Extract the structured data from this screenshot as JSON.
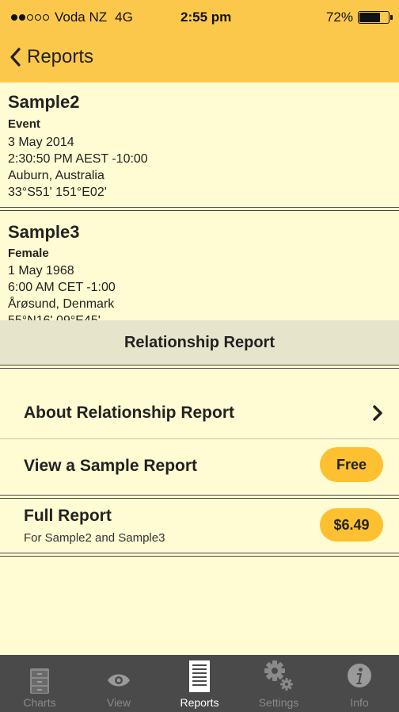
{
  "status_bar": {
    "carrier": "Voda NZ",
    "network": "4G",
    "time": "2:55 pm",
    "battery": "72%",
    "battery_level": 0.72,
    "signal_bars": 2
  },
  "nav": {
    "back_label": "Reports"
  },
  "people": [
    {
      "name": "Sample2",
      "type": "Event",
      "date": "3 May 2014",
      "time": "2:30:50 PM AEST -10:00",
      "place": "Auburn, Australia",
      "coords": "33°S51' 151°E02'"
    },
    {
      "name": "Sample3",
      "type": "Female",
      "date": "1 May 1968",
      "time": "6:00 AM CET -1:00",
      "place": "Årøsund, Denmark",
      "coords": "55°N16' 09°E45'"
    }
  ],
  "section": {
    "title": "Relationship Report"
  },
  "rows": {
    "about": {
      "label": "About Relationship Report"
    },
    "sample": {
      "label": "View a Sample Report",
      "badge": "Free"
    },
    "full": {
      "label": "Full Report",
      "sublabel": "For Sample2 and Sample3",
      "price": "$6.49"
    }
  },
  "tabs": [
    {
      "label": "Charts",
      "icon": "cabinet-icon",
      "active": false
    },
    {
      "label": "View",
      "icon": "eye-icon",
      "active": false
    },
    {
      "label": "Reports",
      "icon": "document-icon",
      "active": true
    },
    {
      "label": "Settings",
      "icon": "gears-icon",
      "active": false
    },
    {
      "label": "Info",
      "icon": "info-icon",
      "active": false
    }
  ],
  "colors": {
    "accent": "#FCC84C",
    "background": "#FFFBD2",
    "section_header": "#E7E4CC",
    "tabbar": "#4A4A4A"
  }
}
